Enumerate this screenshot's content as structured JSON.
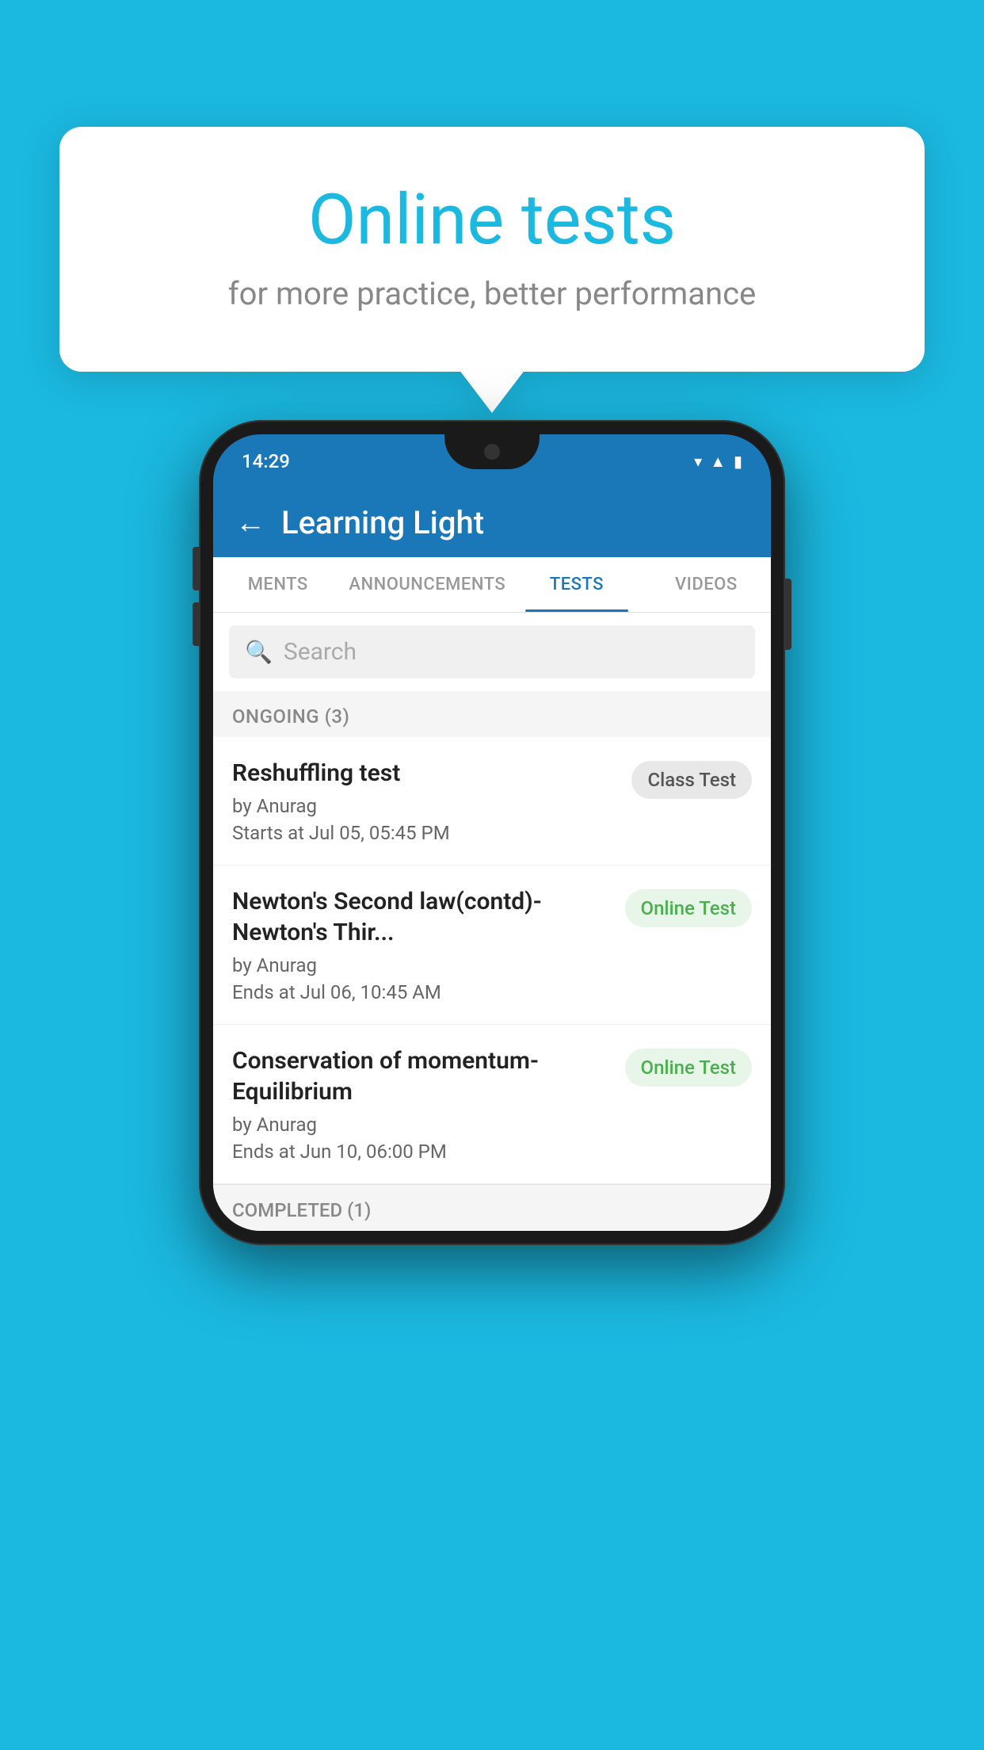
{
  "background_color": "#1BB8E0",
  "bubble": {
    "title": "Online tests",
    "subtitle": "for more practice, better performance"
  },
  "phone": {
    "status_time": "14:29",
    "app_title": "Learning Light",
    "back_label": "←",
    "tabs": [
      {
        "label": "MENTS",
        "active": false
      },
      {
        "label": "ANNOUNCEMENTS",
        "active": false
      },
      {
        "label": "TESTS",
        "active": true
      },
      {
        "label": "VIDEOS",
        "active": false
      }
    ],
    "search_placeholder": "Search",
    "section_ongoing": "ONGOING (3)",
    "tests": [
      {
        "name": "Reshuffling test",
        "author": "by Anurag",
        "time": "Starts at  Jul 05, 05:45 PM",
        "badge": "Class Test",
        "badge_type": "class"
      },
      {
        "name": "Newton's Second law(contd)-Newton's Thir...",
        "author": "by Anurag",
        "time": "Ends at  Jul 06, 10:45 AM",
        "badge": "Online Test",
        "badge_type": "online"
      },
      {
        "name": "Conservation of momentum-Equilibrium",
        "author": "by Anurag",
        "time": "Ends at  Jun 10, 06:00 PM",
        "badge": "Online Test",
        "badge_type": "online"
      }
    ],
    "section_completed": "COMPLETED (1)"
  }
}
